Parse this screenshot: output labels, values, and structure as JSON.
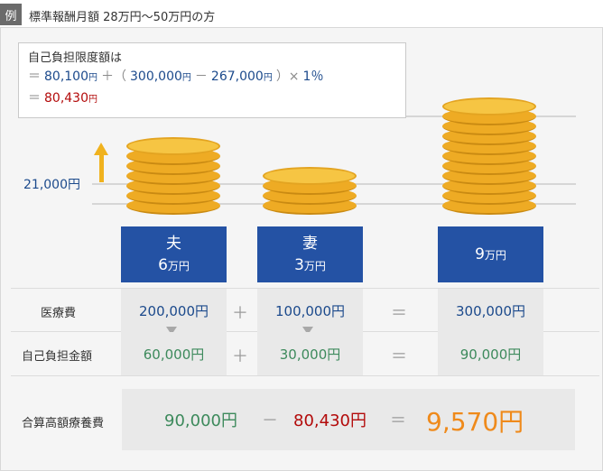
{
  "header": {
    "tag": "例",
    "title": "標準報酬月額 28万円～50万円の方"
  },
  "formula": {
    "title": "自己負担限度額は",
    "line1": {
      "eq": "＝",
      "base": "80,100",
      "yen": "円",
      "plus": "＋（",
      "a": "300,000",
      "minus": "－",
      "b": "267,000",
      "close": "）×",
      "rate": "1％"
    },
    "line2": {
      "eq": "＝",
      "value": "80,430",
      "yen": "円"
    }
  },
  "axis": {
    "label": "21,000円"
  },
  "people": [
    {
      "name": "夫",
      "amount": "6",
      "unit": "万円",
      "coins": 7
    },
    {
      "name": "妻",
      "amount": "3",
      "unit": "万円",
      "coins": 4
    },
    {
      "name": "",
      "amount": "9",
      "unit": "万円",
      "coins": 11
    }
  ],
  "rows": {
    "medical": {
      "label": "医療費",
      "husband": "200,000円",
      "wife": "100,000円",
      "total": "300,000円",
      "op1": "＋",
      "op2": "＝"
    },
    "copay": {
      "label": "自己負担金額",
      "husband": "60,000円",
      "wife": "30,000円",
      "total": "90,000円",
      "op1": "＋",
      "op2": "＝"
    },
    "combined": {
      "label": "合算高額療養費",
      "a": "90,000円",
      "minus": "－",
      "b": "80,430円",
      "eq": "＝",
      "result": "9,570円"
    }
  },
  "colors": {
    "blue": "#2452a4",
    "coin": "#eeab24",
    "orange": "#ef8a1b",
    "red": "#b30b0b",
    "green": "#3d8a5c"
  }
}
